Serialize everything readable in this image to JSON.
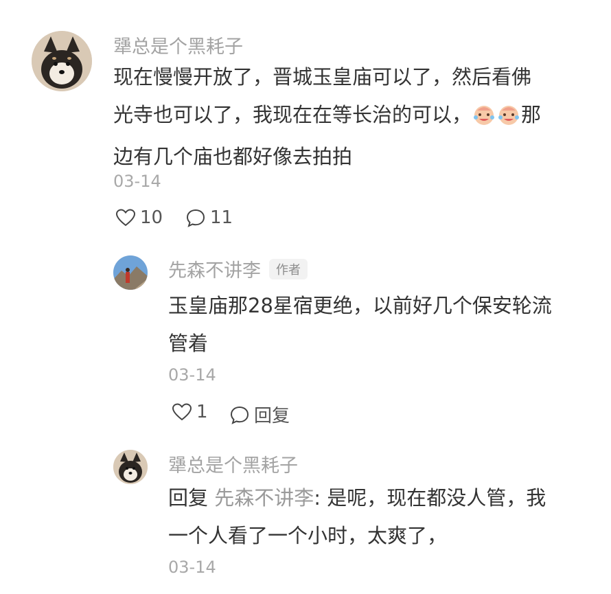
{
  "comments": [
    {
      "username": "犟总是个黑耗子",
      "text_line1": "现在慢慢开放了，晋城玉皇庙可以了，然后看佛",
      "text_line2a": "光寺也可以了，我现在在等长治的可以，",
      "text_line2b": "那",
      "text_line3": "边有几个庙也都好像去拍拍",
      "date": "03-14",
      "likes": "10",
      "comments": "11",
      "emoji": "crying-laugh-emoji"
    }
  ],
  "replies": [
    {
      "username": "先森不讲李",
      "badge": "作者",
      "text_line1": "玉皇庙那28星宿更绝，以前好几个保安轮流",
      "text_line2": "管着",
      "date": "03-14",
      "likes": "1",
      "reply_label": "回复"
    },
    {
      "username": "犟总是个黑耗子",
      "reply_prefix": "回复 ",
      "reply_to": "先森不讲李",
      "text_line1_rest": ": 是呢，现在都没人管，我",
      "text_line2": "一个人看了一个小时，太爽了，",
      "date": "03-14"
    }
  ],
  "colors": {
    "username": "#a3a3a3",
    "text": "#333333",
    "date": "#a8a8a8"
  }
}
